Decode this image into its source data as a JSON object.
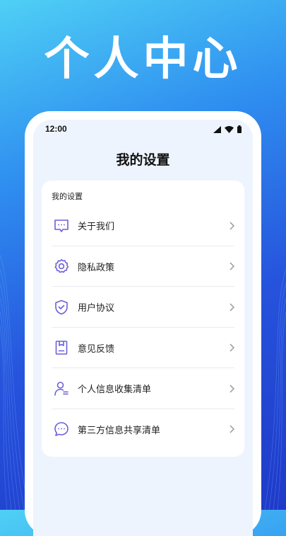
{
  "hero": {
    "title": "个人中心"
  },
  "status_bar": {
    "time": "12:00"
  },
  "header": {
    "title": "我的设置"
  },
  "settings": {
    "section_label": "我的设置",
    "items": [
      {
        "label": "关于我们",
        "icon": "chat-bubble-icon"
      },
      {
        "label": "隐私政策",
        "icon": "gear-icon"
      },
      {
        "label": "用户协议",
        "icon": "shield-check-icon"
      },
      {
        "label": "意见反馈",
        "icon": "clipboard-icon"
      },
      {
        "label": "个人信息收集清单",
        "icon": "user-list-icon"
      },
      {
        "label": "第三方信息共享清单",
        "icon": "ellipsis-circle-icon"
      }
    ]
  },
  "colors": {
    "accent": "#6b5fd8",
    "background_top": "#4fd0f5",
    "background_bottom": "#1f3ac9"
  }
}
